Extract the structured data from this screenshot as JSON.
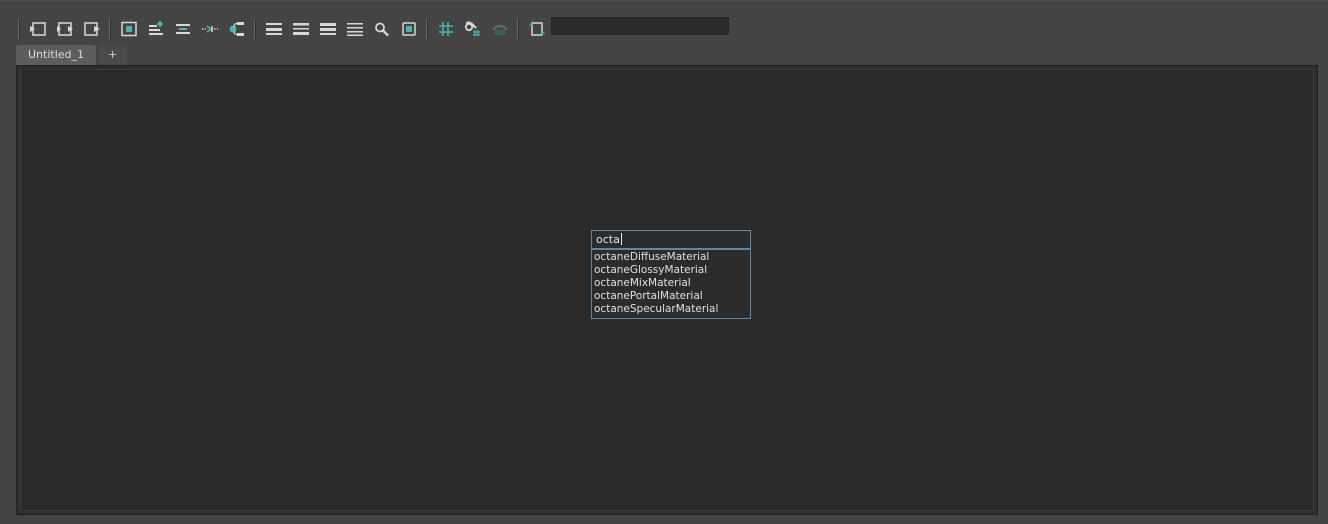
{
  "toolbar": {
    "icons": [
      "graph-input-icon",
      "graph-input-output-icon",
      "graph-output-icon",
      "frame-selection-icon",
      "add-selected-icon",
      "remove-selected-icon",
      "show-connections-icon",
      "clear-graph-icon",
      "simple-mode-icon",
      "connected-mode-icon",
      "full-mode-icon",
      "custom-mode-icon",
      "search-icon",
      "toggle-swatch-icon",
      "grid-icon",
      "snap-to-grid-icon",
      "attribute-filter-icon",
      "reload-icon"
    ],
    "search_value": ""
  },
  "tabs": [
    {
      "label": "Untitled_1"
    },
    {
      "label": "+"
    }
  ],
  "node_search": {
    "value": "octa",
    "suggestions": [
      "octaneDiffuseMaterial",
      "octaneGlossyMaterial",
      "octaneMixMaterial",
      "octanePortalMaterial",
      "octaneSpecularMaterial"
    ]
  },
  "colors": {
    "accent": "#5e86a8",
    "teal_icon": "#4fb3b3",
    "icon": "#d8d8d8"
  }
}
